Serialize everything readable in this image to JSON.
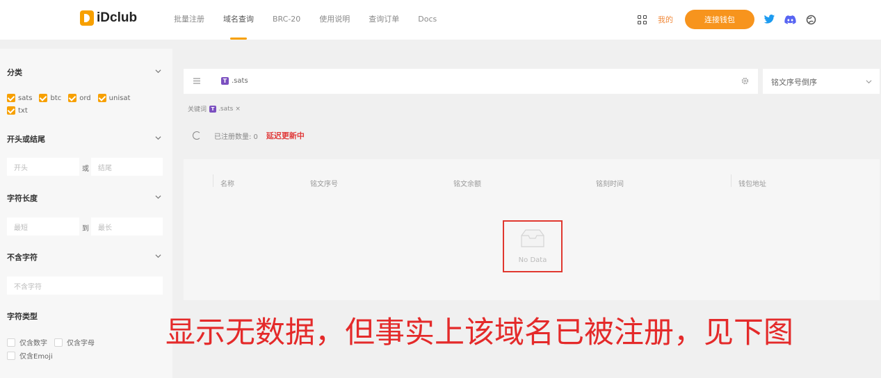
{
  "header": {
    "logo_text": "iDclub",
    "nav": [
      "批量注册",
      "域名查询",
      "BRC-20",
      "使用说明",
      "查询订单",
      "Docs"
    ],
    "active_nav_index": 1,
    "grid_icon": "grid-icon",
    "link_label": "我的",
    "connect_label": "连接钱包",
    "social_icons": [
      "twitter-icon",
      "discord-icon",
      "globe-icon"
    ],
    "accent_color": "#f7941d"
  },
  "sidebar": {
    "category_title": "分类",
    "categories": [
      {
        "label": "sats",
        "checked": true
      },
      {
        "label": "btc",
        "checked": true
      },
      {
        "label": "ord",
        "checked": true
      },
      {
        "label": "unisat",
        "checked": true
      },
      {
        "label": "txt",
        "checked": true
      }
    ],
    "prefix_title": "开头或结尾",
    "prefix_placeholder": "开头",
    "prefix_or": "或",
    "suffix_placeholder": "结尾",
    "length_title": "字符长度",
    "min_placeholder": "最短",
    "length_to": "到",
    "max_placeholder": "最长",
    "exclude_title": "不含字符",
    "exclude_placeholder": "不含字符",
    "type_title": "字符类型",
    "types": [
      {
        "label": "仅含数字",
        "checked": false
      },
      {
        "label": "仅含字母",
        "checked": false
      },
      {
        "label": "仅含Emoji",
        "checked": false
      }
    ]
  },
  "search": {
    "value": ".sats",
    "tag_letter": "T",
    "sort_label": "铭文序号倒序"
  },
  "keyword": {
    "label": "关键词",
    "chip_text": ".sats",
    "chip_close": "×"
  },
  "status": {
    "count_label": "已注册数量: 0",
    "delay_label": "延迟更新中"
  },
  "table": {
    "columns": [
      "名称",
      "铭文序号",
      "铭文余额",
      "铭刻时间",
      "钱包地址"
    ],
    "empty_text": "No Data"
  },
  "annotation": "显示无数据，但事实上该域名已被注册，见下图",
  "colors": {
    "annotation": "#e42a2a",
    "highlight_border": "#e0382f",
    "tag": "#7b4fc0"
  }
}
